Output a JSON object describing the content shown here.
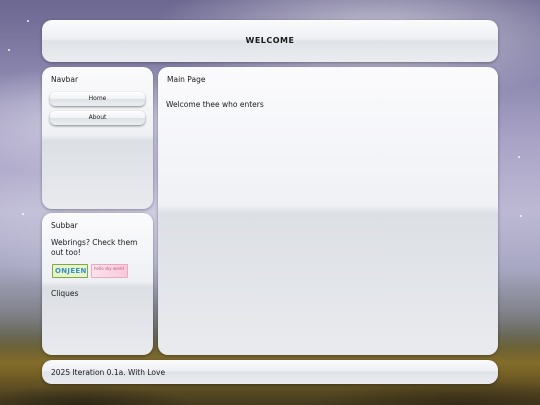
{
  "header": {
    "title": "WELCOME"
  },
  "navbar": {
    "heading": "Navbar",
    "links": [
      {
        "label": "Home"
      },
      {
        "label": "About"
      }
    ]
  },
  "subbar": {
    "heading": "Subbar",
    "webrings_text": "Webrings? Check them out too!",
    "webring_a": "ONJEEN",
    "webring_b": "hello sky world",
    "cliques_heading": "Cliques"
  },
  "main": {
    "heading": "Main Page",
    "body": "Welcome thee who enters"
  },
  "footer": {
    "text": "2025 Iteration 0.1a. With Love"
  }
}
